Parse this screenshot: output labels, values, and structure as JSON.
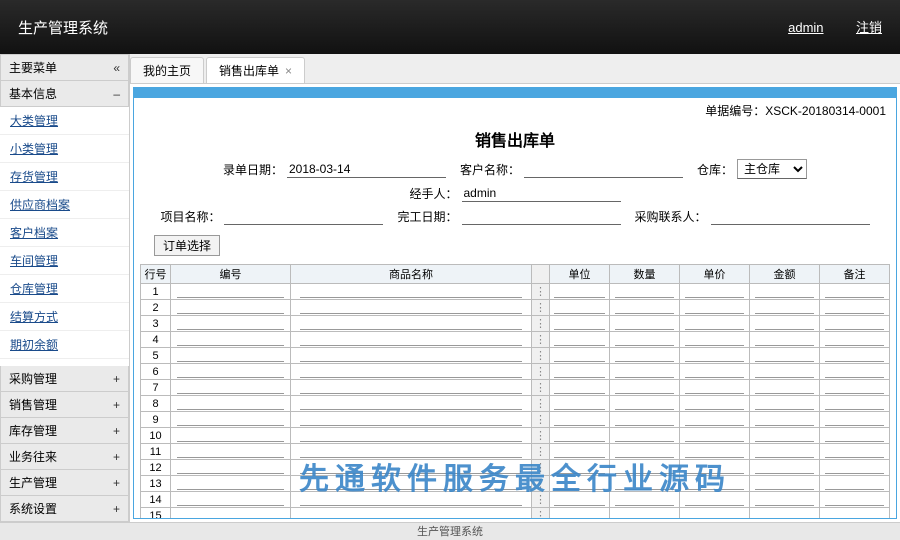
{
  "header": {
    "title": "生产管理系统",
    "user": "admin",
    "logout": "注销"
  },
  "sidebar": {
    "menu_title": "主要菜单",
    "collapse_glyph": "«",
    "sections": {
      "basic": {
        "label": "基本信息",
        "glyph": "–",
        "items": [
          "大类管理",
          "小类管理",
          "存货管理",
          "供应商档案",
          "客户档案",
          "车间管理",
          "仓库管理",
          "结算方式",
          "期初余额"
        ]
      },
      "bottom": [
        {
          "label": "采购管理",
          "glyph": "+"
        },
        {
          "label": "销售管理",
          "glyph": "+"
        },
        {
          "label": "库存管理",
          "glyph": "+"
        },
        {
          "label": "业务往来",
          "glyph": "+"
        },
        {
          "label": "生产管理",
          "glyph": "+"
        },
        {
          "label": "系统设置",
          "glyph": "+"
        }
      ]
    }
  },
  "tabs": [
    {
      "label": "我的主页",
      "closable": false
    },
    {
      "label": "销售出库单",
      "closable": true
    }
  ],
  "active_tab": 1,
  "doc": {
    "no_label": "单据编号：",
    "no_value": "XSCK-20180314-0001",
    "title": "销售出库单",
    "fields": {
      "entry_date": {
        "label": "录单日期：",
        "value": "2018-03-14"
      },
      "customer": {
        "label": "客户名称：",
        "value": ""
      },
      "warehouse": {
        "label": "仓库：",
        "value": "主仓库",
        "options": [
          "主仓库"
        ]
      },
      "handler": {
        "label": "经手人：",
        "value": "admin"
      },
      "project": {
        "label": "项目名称：",
        "value": ""
      },
      "finish_date": {
        "label": "完工日期：",
        "value": ""
      },
      "purchaser": {
        "label": "采购联系人：",
        "value": ""
      }
    },
    "order_button": "订单选择",
    "grid": {
      "columns": [
        "行号",
        "编号",
        "商品名称",
        "",
        "单位",
        "数量",
        "单价",
        "金额",
        "备注"
      ],
      "row_count": 16
    }
  },
  "watermark": "先通软件服务最全行业源码",
  "footer": "生产管理系统"
}
